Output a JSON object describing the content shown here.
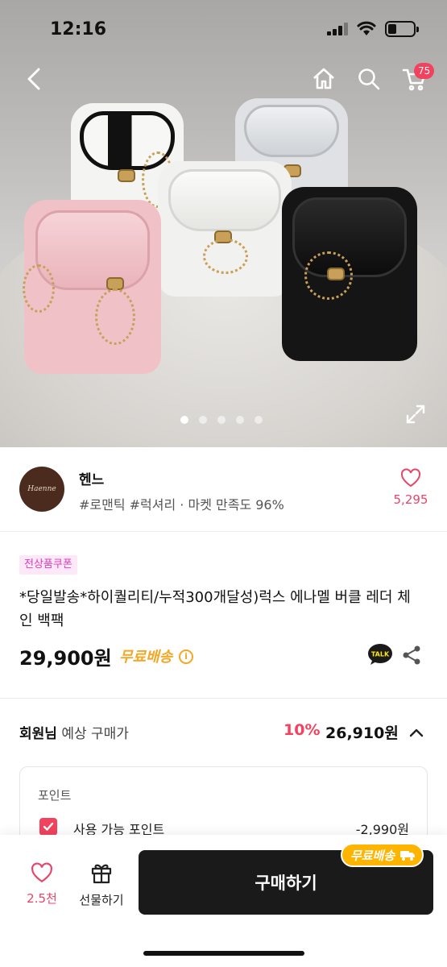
{
  "status_bar": {
    "time": "12:16"
  },
  "nav": {
    "cart_count": "75"
  },
  "carousel": {
    "total": 5,
    "active": 0
  },
  "seller": {
    "logo_text": "Haenne",
    "name": "헨느",
    "tags": "#로맨틱 #럭셔리 · 마켓 만족도 96%",
    "like_count": "5,295"
  },
  "product": {
    "coupon_badge": "전상품쿠폰",
    "title": "*당일발송*하이퀄리티/누적300개달성)럭스 에나멜 버클 레더 체인 백팩",
    "price": "29,900원",
    "shipping": "무료배송",
    "talk_label": "TALK"
  },
  "member_price": {
    "prefix": "회원님",
    "label": "예상 구매가",
    "discount": "10%",
    "price": "26,910원"
  },
  "points": {
    "title": "포인트",
    "usable_label": "사용 가능 포인트",
    "usable_value": "-2,990원",
    "checked": true
  },
  "bottom_bar": {
    "like_label": "2.5천",
    "gift_label": "선물하기",
    "buy_label": "구매하기",
    "free_tag": "무료배송"
  },
  "colors": {
    "accent": "#f2425e",
    "shipping": "#f5a623",
    "buy_bg": "#1a1a1a"
  }
}
